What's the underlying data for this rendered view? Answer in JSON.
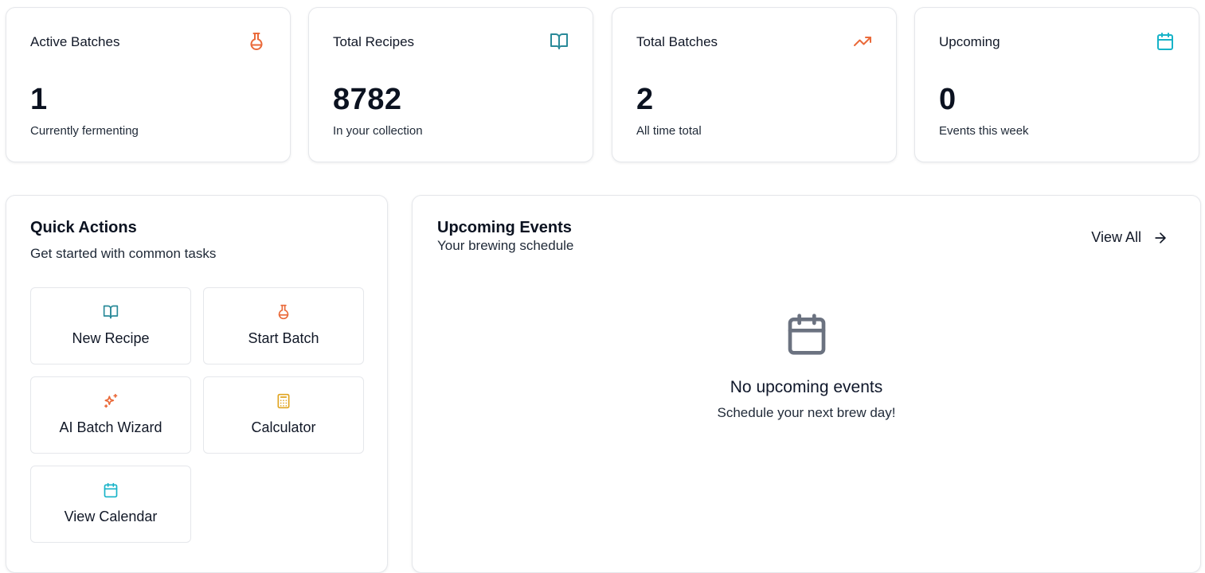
{
  "stats": [
    {
      "title": "Active Batches",
      "value": "1",
      "subtitle": "Currently fermenting",
      "icon": "flask-icon",
      "color": "#ea6a3a"
    },
    {
      "title": "Total Recipes",
      "value": "8782",
      "subtitle": "In your collection",
      "icon": "book-open-icon",
      "color": "#2a8a99"
    },
    {
      "title": "Total Batches",
      "value": "2",
      "subtitle": "All time total",
      "icon": "trending-up-icon",
      "color": "#ea6a3a"
    },
    {
      "title": "Upcoming",
      "value": "0",
      "subtitle": "Events this week",
      "icon": "calendar-icon",
      "color": "#17b3c8"
    }
  ],
  "quick_actions": {
    "title": "Quick Actions",
    "subtitle": "Get started with common tasks",
    "items": [
      {
        "label": "New Recipe",
        "icon": "book-open-icon",
        "color": "#2a8a99"
      },
      {
        "label": "Start Batch",
        "icon": "flask-icon",
        "color": "#ea6a3a"
      },
      {
        "label": "AI Batch Wizard",
        "icon": "sparkles-icon",
        "color": "#ea6a3a"
      },
      {
        "label": "Calculator",
        "icon": "calculator-icon",
        "color": "#e0a420"
      },
      {
        "label": "View Calendar",
        "icon": "calendar-icon",
        "color": "#17b3c8"
      }
    ]
  },
  "events": {
    "title": "Upcoming Events",
    "subtitle": "Your brewing schedule",
    "view_all_label": "View All",
    "empty_title": "No upcoming events",
    "empty_subtitle": "Schedule your next brew day!",
    "empty_icon": "calendar-icon",
    "empty_icon_color": "#6b7280"
  }
}
